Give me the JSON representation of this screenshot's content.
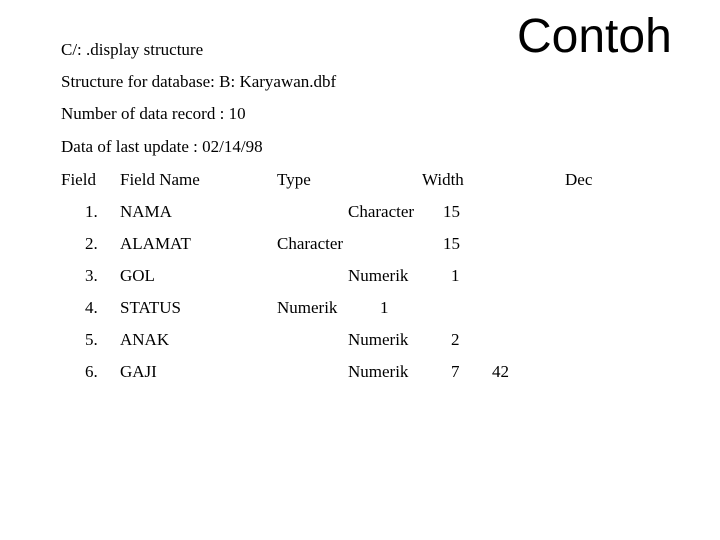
{
  "title": "Contoh",
  "header_lines": {
    "command": "C/: .display structure",
    "structure": "Structure for database: B: Karyawan.dbf",
    "records": "Number of data record : 10",
    "last_update": "Data of last update : 02/14/98"
  },
  "columns": {
    "field": "Field",
    "field_name": "Field Name",
    "type": "Type",
    "width": "Width",
    "dec": "Dec"
  },
  "rows": [
    {
      "num": "1.",
      "name": "NAMA",
      "type": "Character",
      "width": "15",
      "dec": ""
    },
    {
      "num": "2.",
      "name": "ALAMAT",
      "type": "Character",
      "width": "15",
      "dec": ""
    },
    {
      "num": "3.",
      "name": "GOL",
      "type": "Numerik",
      "width": "1",
      "dec": ""
    },
    {
      "num": "4.",
      "name": "STATUS",
      "type": "Numerik",
      "width": "1",
      "dec": ""
    },
    {
      "num": "5.",
      "name": "ANAK",
      "type": "Numerik",
      "width": "2",
      "dec": ""
    },
    {
      "num": "6.",
      "name": "GAJI",
      "type": "Numerik",
      "width": "7",
      "dec": "42"
    }
  ]
}
